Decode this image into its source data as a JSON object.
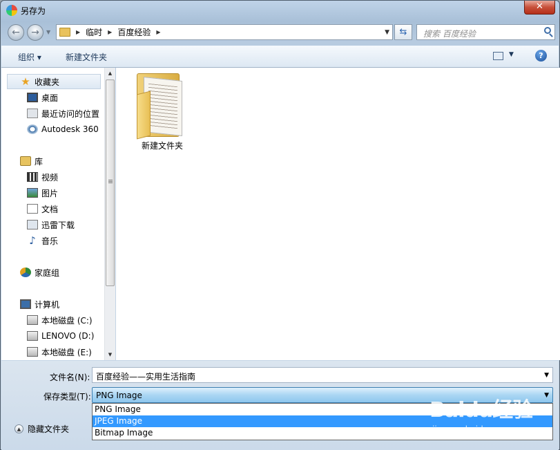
{
  "window": {
    "title": "另存为",
    "close_glyph": "✕"
  },
  "nav": {
    "back_glyph": "←",
    "forward_glyph": "→",
    "breadcrumb": [
      "临时",
      "百度经验"
    ],
    "refresh_glyph": "⇆",
    "search_placeholder": "搜索 百度经验"
  },
  "toolbar": {
    "organize": "组织 ▾",
    "new_folder": "新建文件夹",
    "help": "?"
  },
  "sidebar": {
    "favorites": {
      "label": "收藏夹",
      "items": [
        "桌面",
        "最近访问的位置",
        "Autodesk 360"
      ]
    },
    "libraries": {
      "label": "库",
      "items": [
        "视频",
        "图片",
        "文档",
        "迅雷下载",
        "音乐"
      ]
    },
    "homegroup": {
      "label": "家庭组"
    },
    "computer": {
      "label": "计算机",
      "items": [
        "本地磁盘 (C:)",
        "LENOVO (D:)",
        "本地磁盘 (E:)"
      ]
    }
  },
  "content": {
    "items": [
      {
        "name": "新建文件夹",
        "type": "folder-icon"
      }
    ]
  },
  "form": {
    "filename_label": "文件名(N):",
    "filename_value": "百度经验——实用生活指南",
    "filetype_label": "保存类型(T):",
    "filetype_value": "PNG Image",
    "filetype_options": [
      "PNG Image",
      "JPEG Image",
      "Bitmap Image"
    ],
    "highlighted_option": 1,
    "hide_folders": "隐藏文件夹"
  },
  "watermark": {
    "logo": "Baidu经验",
    "url": "jingyan.baidu.com"
  },
  "colors": {
    "selection": "#3399ff",
    "select_border": "#3c7fb1",
    "close": "#c7503a"
  }
}
